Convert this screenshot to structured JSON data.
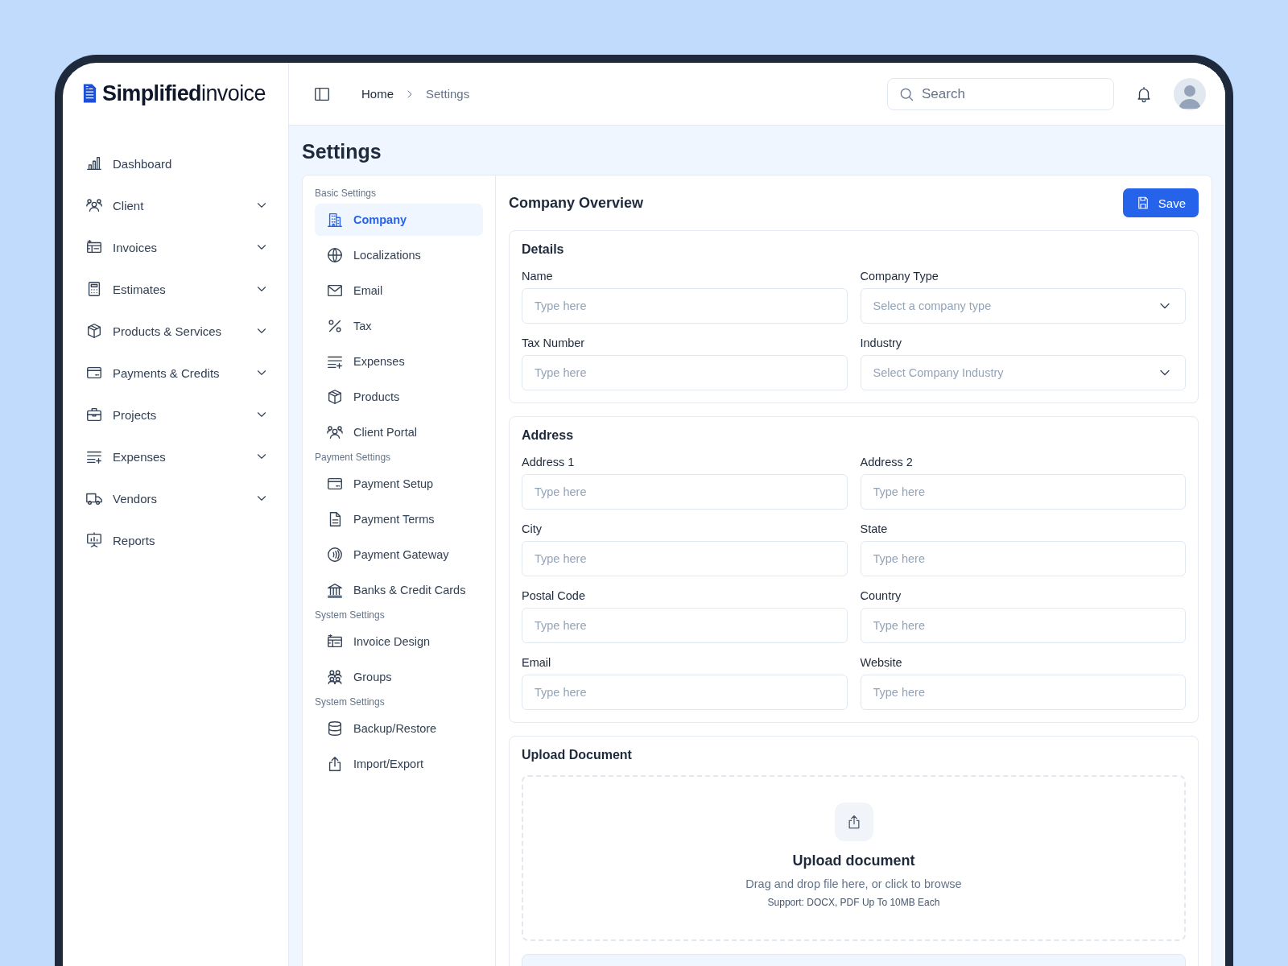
{
  "logo": {
    "bold": "Simplified",
    "light": "invoice"
  },
  "sidebar": {
    "items": [
      {
        "label": "Dashboard",
        "expandable": false,
        "selected": false
      },
      {
        "label": "Client",
        "expandable": true,
        "selected": false
      },
      {
        "label": "Invoices",
        "expandable": true,
        "selected": false
      },
      {
        "label": "Estimates",
        "expandable": true,
        "selected": false
      },
      {
        "label": "Products & Services",
        "expandable": true,
        "selected": false
      },
      {
        "label": "Payments & Credits",
        "expandable": true,
        "selected": false
      },
      {
        "label": "Projects",
        "expandable": true,
        "selected": false
      },
      {
        "label": "Expenses",
        "expandable": true,
        "selected": false
      },
      {
        "label": "Vendors",
        "expandable": true,
        "selected": false
      },
      {
        "label": "Reports",
        "expandable": false,
        "selected": false
      }
    ]
  },
  "header": {
    "breadcrumb": [
      "Home",
      "Settings"
    ],
    "search": {
      "placeholder": "Search"
    }
  },
  "page_title": "Settings",
  "settings_menu": [
    {
      "heading": "Basic Settings",
      "items": [
        {
          "label": "Company",
          "selected": true
        },
        {
          "label": "Localizations",
          "selected": false
        },
        {
          "label": "Email",
          "selected": false
        },
        {
          "label": "Tax",
          "selected": false
        },
        {
          "label": "Expenses",
          "selected": false
        },
        {
          "label": "Products",
          "selected": false
        },
        {
          "label": "Client Portal",
          "selected": false
        }
      ]
    },
    {
      "heading": "Payment Settings",
      "items": [
        {
          "label": "Payment Setup",
          "selected": false
        },
        {
          "label": "Payment Terms",
          "selected": false
        },
        {
          "label": "Payment Gateway",
          "selected": false
        },
        {
          "label": "Banks & Credit Cards",
          "selected": false
        }
      ]
    },
    {
      "heading": "System Settings",
      "items": [
        {
          "label": "Invoice Design",
          "selected": false
        },
        {
          "label": "Groups",
          "selected": false
        }
      ]
    },
    {
      "heading": "System Settings",
      "items": [
        {
          "label": "Backup/Restore",
          "selected": false
        },
        {
          "label": "Import/Export",
          "selected": false
        }
      ]
    }
  ],
  "content": {
    "title": "Company Overview",
    "save_button": "Save",
    "sections": [
      {
        "title": "Details",
        "fields": [
          {
            "label": "Name",
            "kind": "text",
            "placeholder": "Type here"
          },
          {
            "label": "Company Type",
            "kind": "select",
            "placeholder": "Select a company type"
          },
          {
            "label": "Tax Number",
            "kind": "text",
            "placeholder": "Type here"
          },
          {
            "label": "Industry",
            "kind": "select",
            "placeholder": "Select  Company Industry"
          }
        ]
      },
      {
        "title": "Address",
        "fields": [
          {
            "label": "Address 1",
            "kind": "text",
            "placeholder": "Type here"
          },
          {
            "label": "Address 2",
            "kind": "text",
            "placeholder": "Type here"
          },
          {
            "label": "City",
            "kind": "text",
            "placeholder": "Type here"
          },
          {
            "label": "State",
            "kind": "text",
            "placeholder": "Type here"
          },
          {
            "label": "Postal Code",
            "kind": "text",
            "placeholder": "Type here"
          },
          {
            "label": "Country",
            "kind": "text",
            "placeholder": "Type here"
          },
          {
            "label": "Email",
            "kind": "text",
            "placeholder": "Type here"
          },
          {
            "label": "Website",
            "kind": "text",
            "placeholder": "Type here"
          }
        ]
      }
    ],
    "upload": {
      "title": "Upload Document",
      "heading": "Upload document",
      "hint": "Drag and drop file here, or click to browse",
      "support": "Support: DOCX, PDF Up To 10MB Each"
    }
  }
}
